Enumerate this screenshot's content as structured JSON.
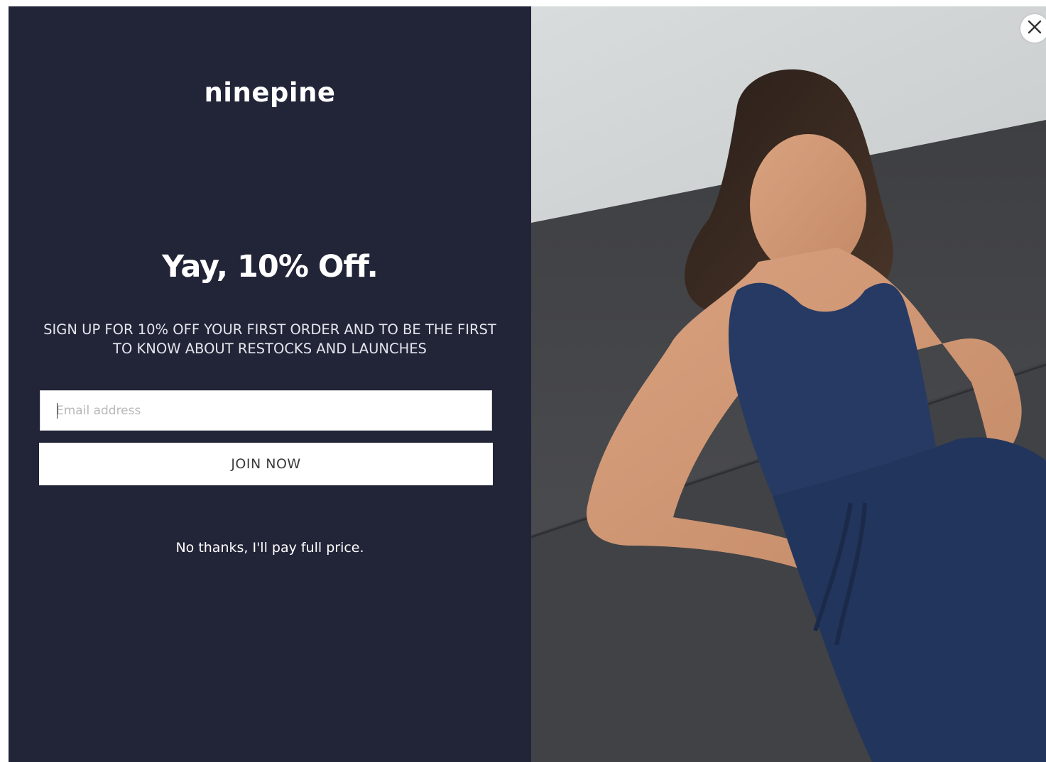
{
  "brand": {
    "logo_text": "ninepine"
  },
  "offer": {
    "headline": "Yay, 10% Off.",
    "subtext": "SIGN UP FOR 10% OFF YOUR FIRST ORDER AND TO BE THE FIRST TO KNOW ABOUT RESTOCKS AND LAUNCHES"
  },
  "form": {
    "email_placeholder": "Email address",
    "email_value": "",
    "submit_label": "JOIN NOW"
  },
  "decline_label": "No thanks, I'll pay full price.",
  "close_icon": "close-icon",
  "colors": {
    "panel_bg": "#222438",
    "text": "#ffffff",
    "button_bg": "#ffffff",
    "button_text": "#3a3a3a"
  }
}
